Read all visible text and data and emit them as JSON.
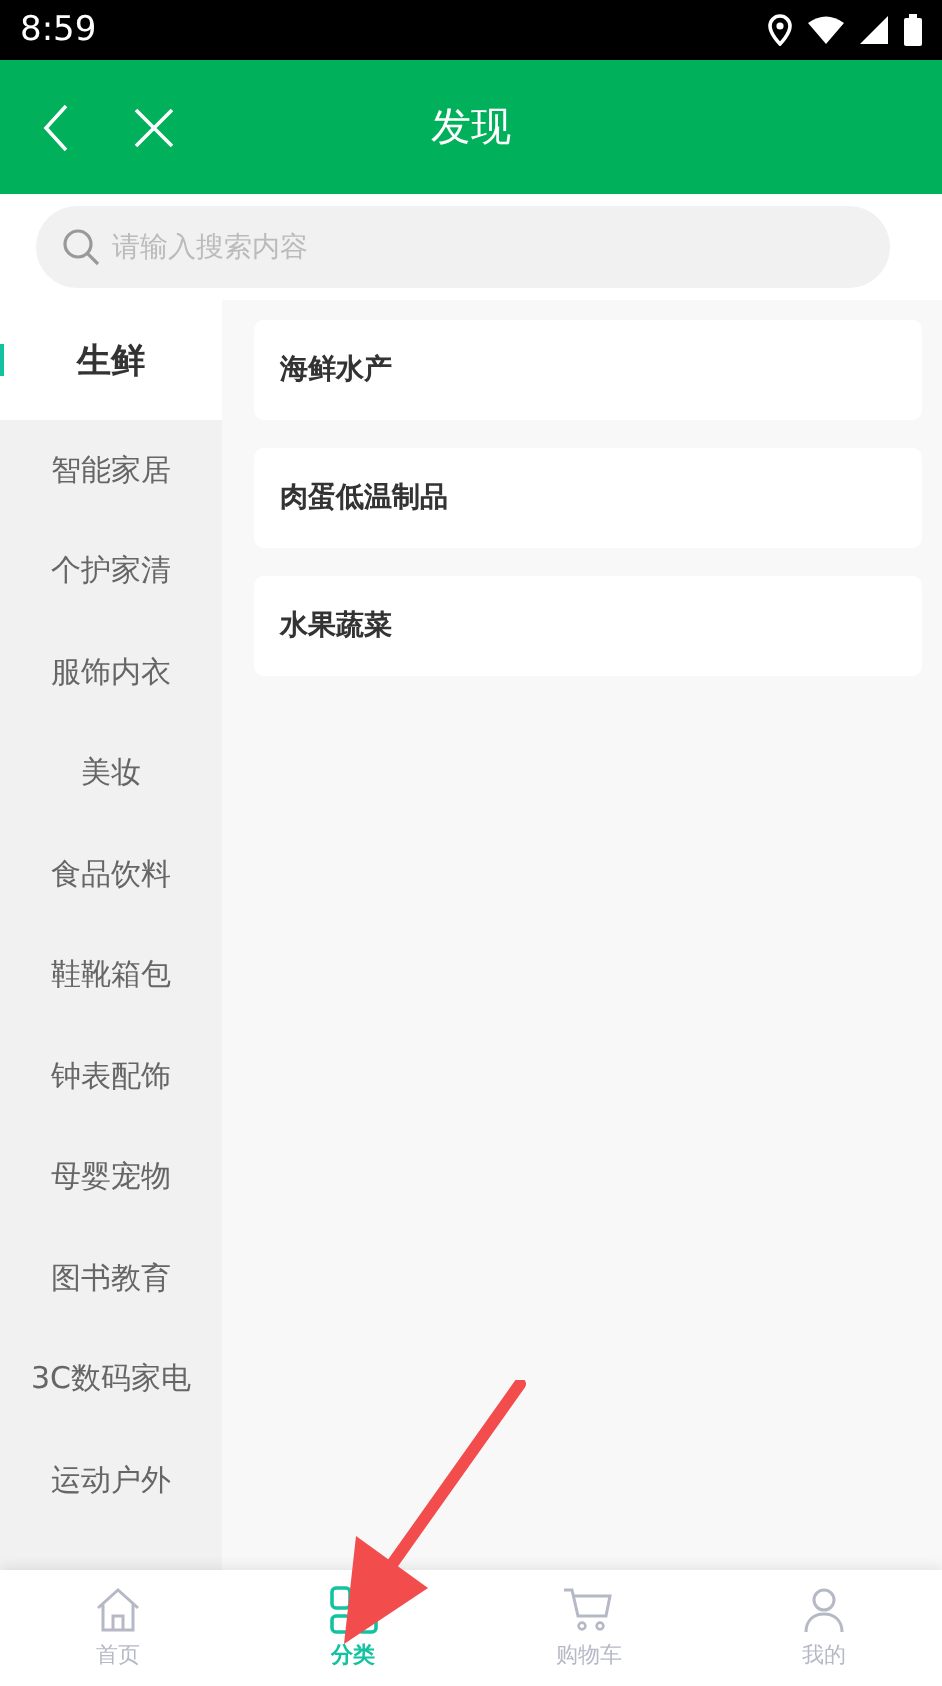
{
  "status_bar": {
    "time": "8:59"
  },
  "header": {
    "title": "发现"
  },
  "search": {
    "placeholder": "请输入搜索内容"
  },
  "sidebar": {
    "items": [
      {
        "label": "生鲜",
        "selected": true
      },
      {
        "label": "智能家居",
        "selected": false
      },
      {
        "label": "个护家清",
        "selected": false
      },
      {
        "label": "服饰内衣",
        "selected": false
      },
      {
        "label": "美妆",
        "selected": false
      },
      {
        "label": "食品饮料",
        "selected": false
      },
      {
        "label": "鞋靴箱包",
        "selected": false
      },
      {
        "label": "钟表配饰",
        "selected": false
      },
      {
        "label": "母婴宠物",
        "selected": false
      },
      {
        "label": "图书教育",
        "selected": false
      },
      {
        "label": "3C数码家电",
        "selected": false
      },
      {
        "label": "运动户外",
        "selected": false
      }
    ]
  },
  "subcategories": [
    {
      "label": "海鲜水产"
    },
    {
      "label": "肉蛋低温制品"
    },
    {
      "label": "水果蔬菜"
    }
  ],
  "bottom_nav": [
    {
      "label": "首页",
      "kind": "home",
      "selected": false
    },
    {
      "label": "分类",
      "kind": "category",
      "selected": true
    },
    {
      "label": "购物车",
      "kind": "cart",
      "selected": false
    },
    {
      "label": "我的",
      "kind": "profile",
      "selected": false
    }
  ]
}
